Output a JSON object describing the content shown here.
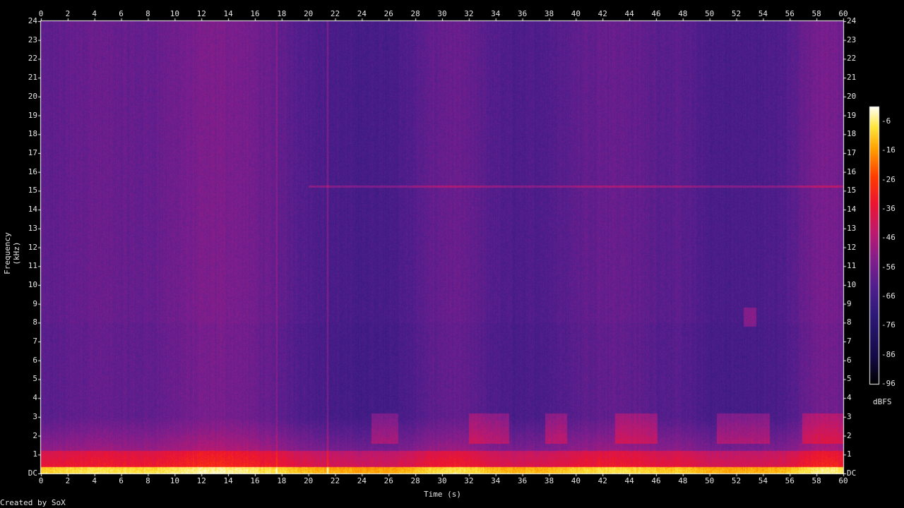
{
  "credit": "Created by SoX",
  "chart_data": {
    "type": "heatmap",
    "title": "",
    "xlabel": "Time (s)",
    "ylabel": "Frequency (kHz)",
    "xlim": [
      0,
      60
    ],
    "ylim": [
      0,
      24
    ],
    "x_ticks": [
      "0",
      "2",
      "4",
      "6",
      "8",
      "10",
      "12",
      "14",
      "16",
      "18",
      "20",
      "22",
      "24",
      "26",
      "28",
      "30",
      "32",
      "34",
      "36",
      "38",
      "40",
      "42",
      "44",
      "46",
      "48",
      "50",
      "52",
      "54",
      "56",
      "58",
      "60"
    ],
    "y_ticks": [
      "DC",
      "1",
      "2",
      "3",
      "4",
      "5",
      "6",
      "7",
      "8",
      "9",
      "10",
      "11",
      "12",
      "13",
      "14",
      "15",
      "16",
      "17",
      "18",
      "19",
      "20",
      "21",
      "22",
      "23",
      "24"
    ],
    "colorbar": {
      "unit": "dBFS",
      "ticks": [
        "-6",
        "-16",
        "-26",
        "-36",
        "-46",
        "-56",
        "-66",
        "-76",
        "-86",
        "-96"
      ],
      "range": [
        -96,
        -6
      ]
    },
    "colors": {
      "background": "#000000",
      "low": "#1a0a5a",
      "mid": "#5a1a8a",
      "high": "#e01a3a",
      "peak": "#ffffe0"
    }
  }
}
